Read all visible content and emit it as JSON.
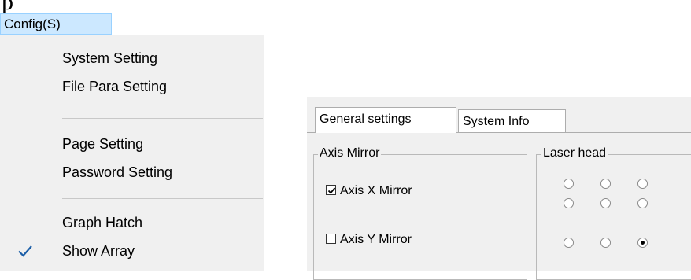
{
  "menu": {
    "bar_label": "Config(S)",
    "items": [
      {
        "label": "System Setting",
        "checked": false
      },
      {
        "label": "File Para Setting",
        "checked": false
      },
      {
        "label": "Page Setting",
        "checked": false
      },
      {
        "label": "Password Setting",
        "checked": false
      },
      {
        "label": "Graph Hatch",
        "checked": false
      },
      {
        "label": "Show Array",
        "checked": true
      }
    ]
  },
  "dialog": {
    "tabs": [
      {
        "label": "General settings",
        "active": true
      },
      {
        "label": "System Info",
        "active": false
      }
    ],
    "axis_mirror": {
      "title": "Axis Mirror",
      "x_label": "Axis X Mirror",
      "x_checked": true,
      "y_label": "Axis Y Mirror",
      "y_checked": false
    },
    "laser_head": {
      "title": "Laser head",
      "selected": "row3-col3"
    }
  },
  "colors": {
    "menu_highlight": "#cce8ff",
    "menu_background": "#f0f0f0",
    "dialog_background": "#f0f0f0"
  }
}
